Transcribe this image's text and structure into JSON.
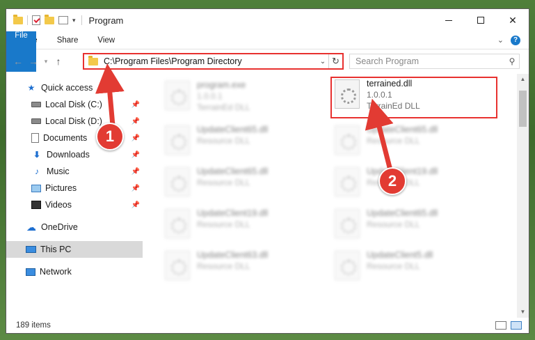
{
  "window": {
    "title": "Program"
  },
  "ribbon": {
    "tabs": [
      "File",
      "Home",
      "Share",
      "View"
    ]
  },
  "address_bar": {
    "path": "C:\\Program Files\\Program Directory"
  },
  "search": {
    "placeholder": "Search Program"
  },
  "sidebar": {
    "items": [
      {
        "label": "Quick access",
        "icon": "star-icon",
        "pinned": false
      },
      {
        "label": "Local Disk (C:)",
        "icon": "disk-icon",
        "pinned": true
      },
      {
        "label": "Local Disk (D:)",
        "icon": "disk-icon",
        "pinned": true
      },
      {
        "label": "Documents",
        "icon": "document-icon",
        "pinned": true
      },
      {
        "label": "Downloads",
        "icon": "download-icon",
        "pinned": true
      },
      {
        "label": "Music",
        "icon": "music-icon",
        "pinned": true
      },
      {
        "label": "Pictures",
        "icon": "pictures-icon",
        "pinned": true
      },
      {
        "label": "Videos",
        "icon": "videos-icon",
        "pinned": true
      },
      {
        "label": "OneDrive",
        "icon": "cloud-icon"
      },
      {
        "label": "This PC",
        "icon": "pc-icon",
        "selected": true
      },
      {
        "label": "Network",
        "icon": "network-icon"
      }
    ]
  },
  "files": [
    {
      "name": "program.exe",
      "line2": "1.0.0.1",
      "line3": "TerrainEd DLL",
      "blurred": true
    },
    {
      "name": "terrained.dll",
      "line2": "1.0.0.1",
      "line3": "TerrainEd DLL",
      "blurred": false,
      "highlighted": true
    },
    {
      "name": "UpdateClient65.dll",
      "line2": "Resource DLL",
      "blurred": true
    },
    {
      "name": "UpdateClient65.dll",
      "line2": "Resource DLL",
      "blurred": true
    },
    {
      "name": "UpdateClient65.dll",
      "line2": "Resource DLL",
      "blurred": true
    },
    {
      "name": "UpdateClient19.dll",
      "line2": "Resource DLL",
      "blurred": true
    },
    {
      "name": "UpdateClient19.dll",
      "line2": "Resource DLL",
      "blurred": true
    },
    {
      "name": "UpdateClient65.dll",
      "line2": "Resource DLL",
      "blurred": true
    },
    {
      "name": "UpdateClient63.dll",
      "line2": "Resource DLL",
      "blurred": true
    },
    {
      "name": "UpdateClient5.dll",
      "line2": "Resource DLL",
      "blurred": true
    }
  ],
  "status": {
    "item_count": "189 items"
  },
  "annotations": {
    "step1": "1",
    "step2": "2",
    "color": "#e23b33"
  }
}
